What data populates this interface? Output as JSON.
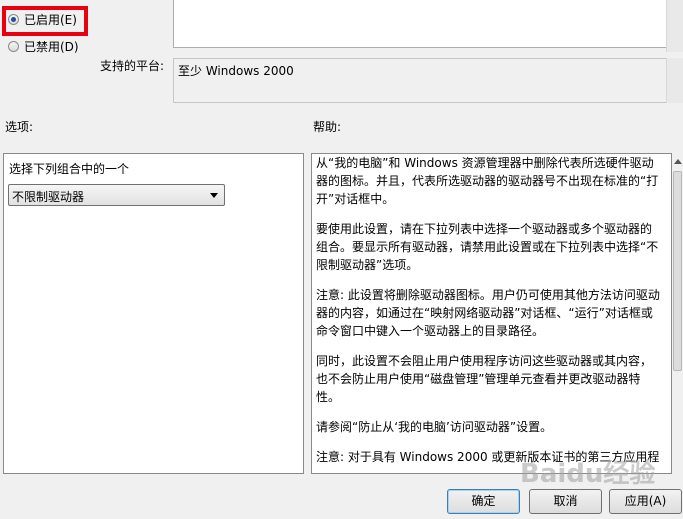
{
  "state": {
    "enabled_label": "已启用(E)",
    "disabled_label": "已禁用(D)",
    "selected": "enabled"
  },
  "platform": {
    "label": "支持的平台:",
    "value": "至少 Windows 2000"
  },
  "options": {
    "heading": "选项:",
    "combo_label": "选择下列组合中的一个",
    "combo_value": "不限制驱动器"
  },
  "help": {
    "heading": "帮助:",
    "paragraphs": [
      "从“我的电脑”和 Windows 资源管理器中删除代表所选硬件驱动器的图标。并且，代表所选驱动器的驱动器号不出现在标准的“打开”对话框中。",
      "要使用此设置，请在下拉列表中选择一个驱动器或多个驱动器的组合。要显示所有驱动器，请禁用此设置或在下拉列表中选择“不限制驱动器”选项。",
      "注意: 此设置将删除驱动器图标。用户仍可使用其他方法访问驱动器的内容，如通过在“映射网络驱动器”对话框、“运行”对话框或命令窗口中键入一个驱动器上的目录路径。",
      "同时，此设置不会阻止用户使用程序访问这些驱动器或其内容，也不会防止用户使用“磁盘管理”管理单元查看并更改驱动器特性。",
      "请参阅“防止从‘我的电脑’访问驱动器”设置。",
      "注意: 对于具有 Windows 2000 或更新版本证书的第三方应用程"
    ]
  },
  "buttons": {
    "ok": "确定",
    "cancel": "取消",
    "apply": "应用(A)"
  },
  "watermark": "Baidu经验"
}
